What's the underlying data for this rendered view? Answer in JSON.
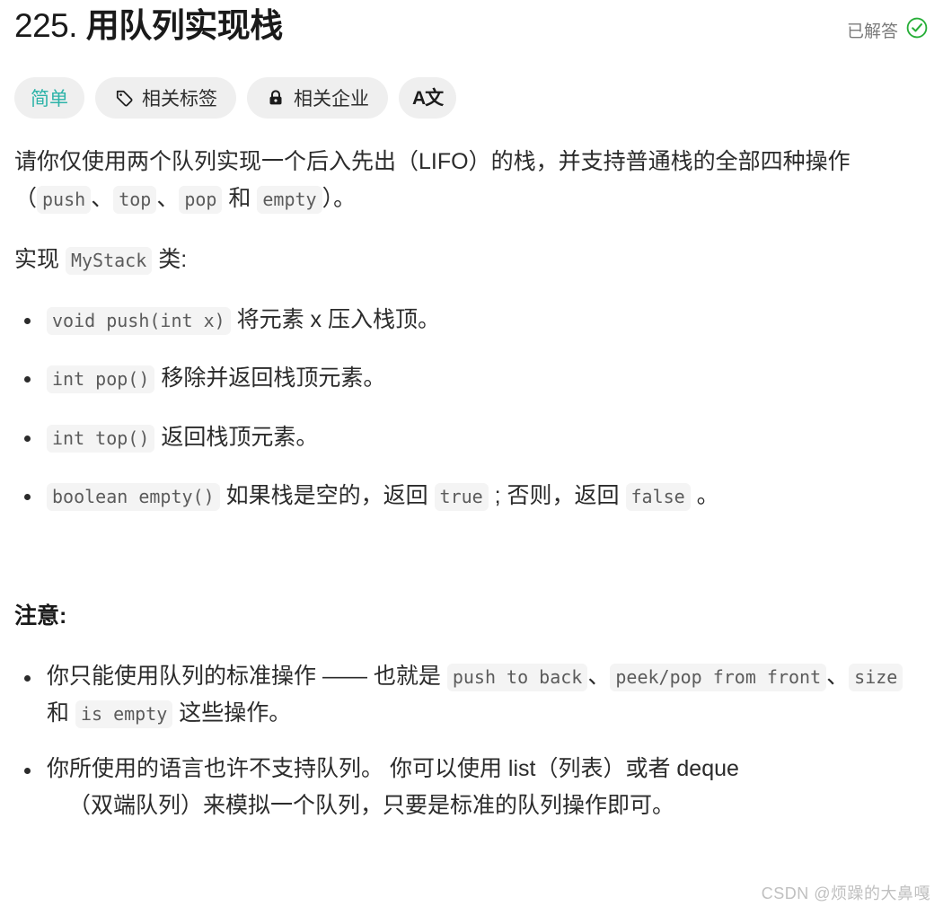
{
  "header": {
    "problem_number": "225.",
    "problem_title": "用队列实现栈",
    "status_label": "已解答",
    "status_icon": "check-circle-icon",
    "status_color": "#27ae38"
  },
  "toolbar": {
    "difficulty": {
      "label": "简单",
      "color": "#2db3a8"
    },
    "items": [
      {
        "icon": "tag-icon",
        "label": "相关标签"
      },
      {
        "icon": "lock-icon",
        "label": "相关企业"
      }
    ],
    "translate_button": {
      "icon": "translate-icon",
      "label": "A文"
    }
  },
  "description": {
    "intro": {
      "part1": "请你仅使用两个队列实现一个后入先出（LIFO）的栈，并支持普通栈的全部四种操作（",
      "code1": "push",
      "sep1": "、",
      "code2": "top",
      "sep2": "、",
      "code3": "pop",
      "sep3": " 和 ",
      "code4": "empty",
      "tail": "）。"
    },
    "implement": {
      "prefix": "实现 ",
      "code": "MyStack",
      "suffix": " 类:"
    },
    "methods": [
      {
        "code": "void push(int x)",
        "text": " 将元素 x 压入栈顶。"
      },
      {
        "code": "int pop()",
        "text": " 移除并返回栈顶元素。"
      },
      {
        "code": "int top()",
        "text": " 返回栈顶元素。"
      }
    ],
    "empty_method": {
      "code": "boolean empty()",
      "text1": " 如果栈是空的，返回 ",
      "code_true": "true",
      "text2": " ; 否则，返回 ",
      "code_false": "false",
      "text3": " 。"
    }
  },
  "notes": {
    "heading": "注意:",
    "item1": {
      "text1": "你只能使用队列的标准操作 —— 也就是 ",
      "code1": "push to back",
      "sep1": "、",
      "code2": "peek/pop from front",
      "sep2": "、",
      "code3": "size",
      "sep3": " 和 ",
      "code4": "is empty",
      "text2": " 这些操作。"
    },
    "item2": {
      "line1": "你所使用的语言也许不支持队列。 你可以使用 list（列表）或者 deque",
      "line2": "（双端队列）来模拟一个队列，只要是标准的队列操作即可。"
    }
  },
  "watermark": {
    "text": "CSDN @烦躁的大鼻嘎"
  }
}
